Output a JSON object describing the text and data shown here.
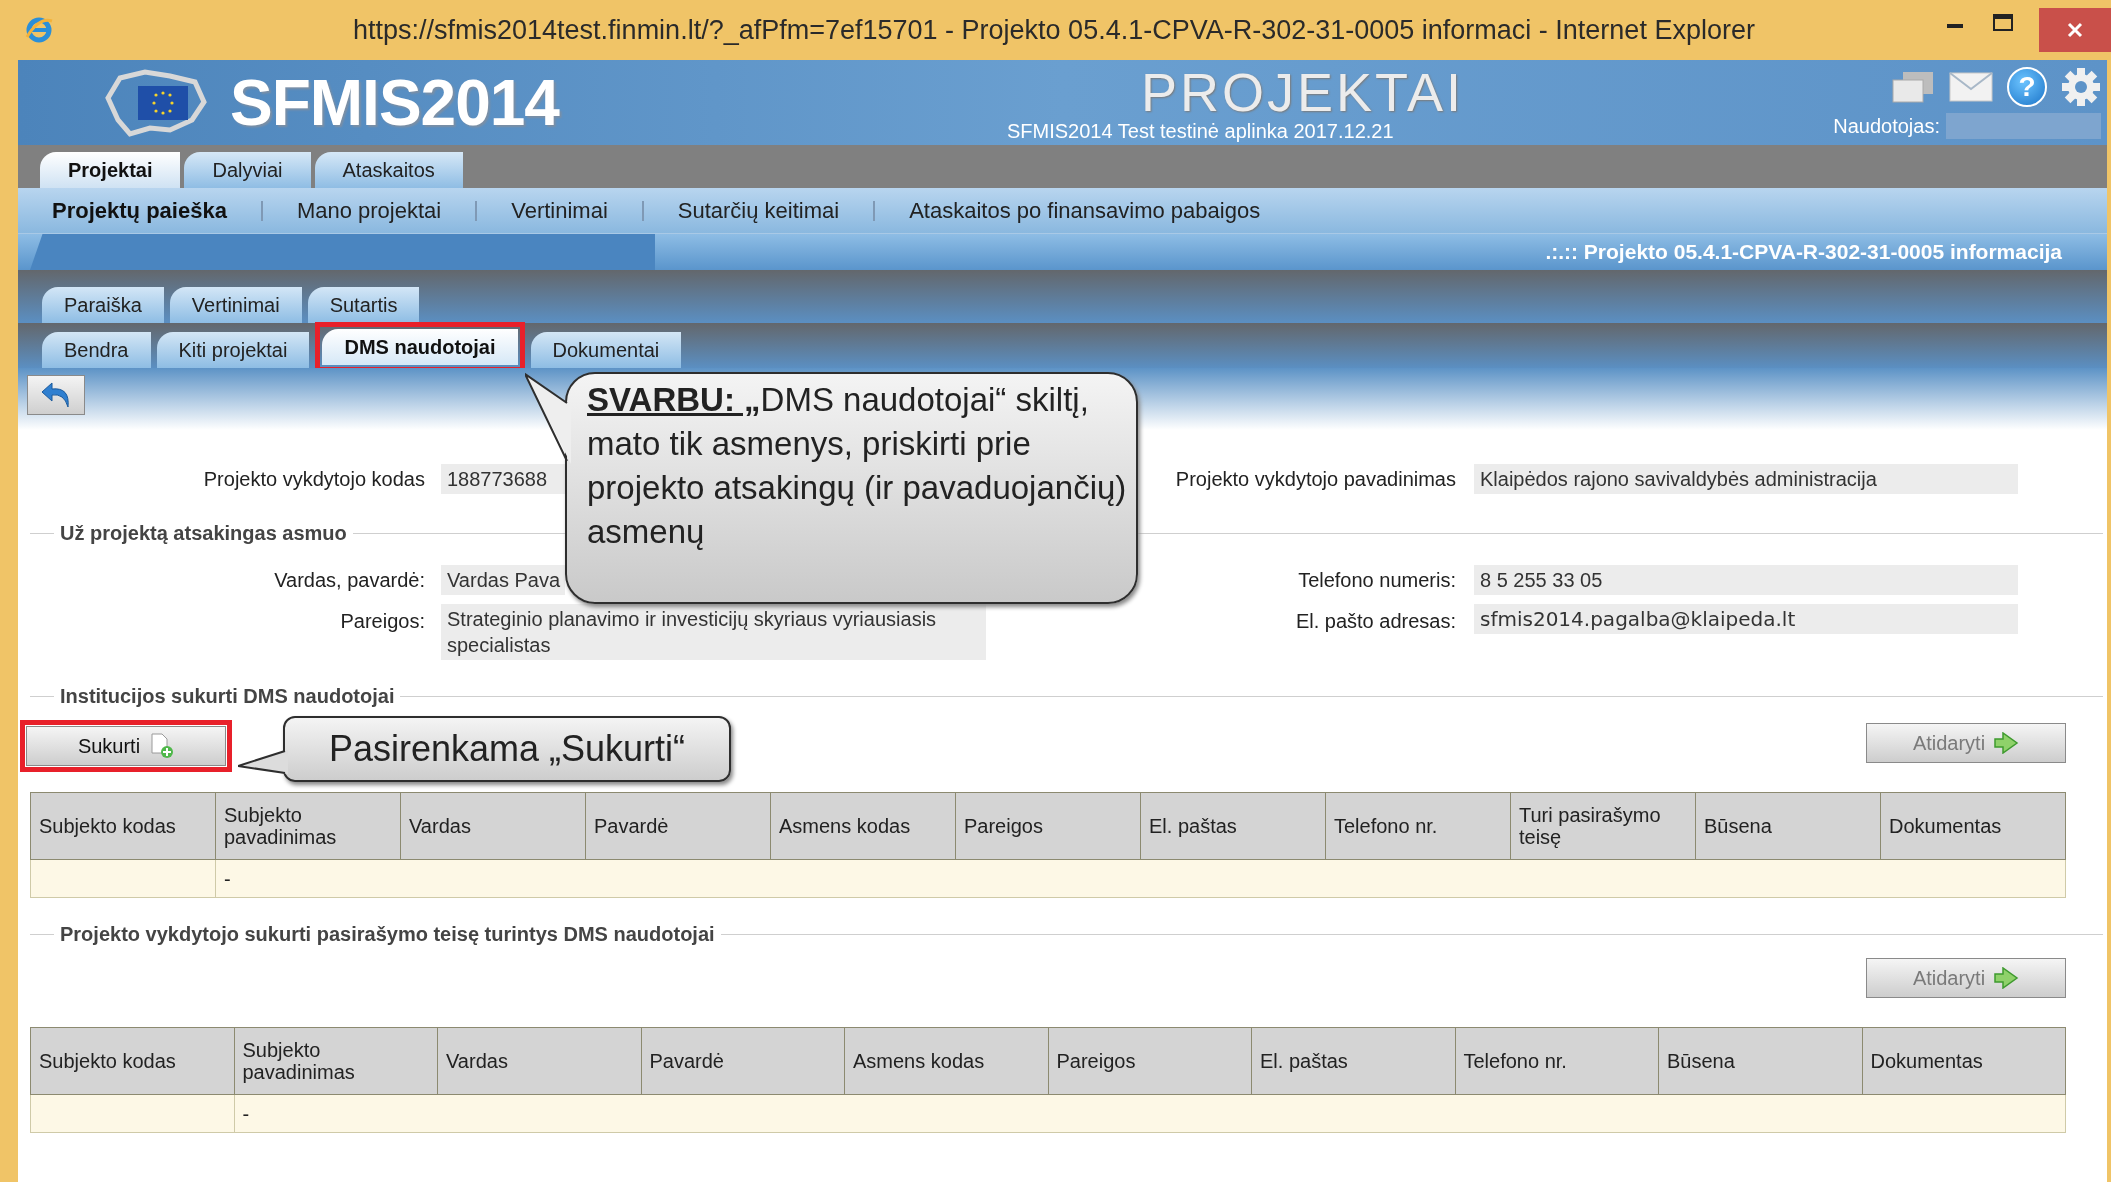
{
  "window": {
    "title": "https://sfmis2014test.finmin.lt/?_afPfm=7ef15701 - Projekto 05.4.1-CPVA-R-302-31-0005 informaci - Internet Explorer"
  },
  "header": {
    "logo_text": "SFMIS2014",
    "app_title": "PROJEKTAI",
    "environment": "SFMIS2014 Test testinė aplinka 2017.12.21",
    "user_label": "Naudotojas:",
    "help_glyph": "?"
  },
  "main_tabs": [
    {
      "label": "Projektai",
      "selected": true
    },
    {
      "label": "Dalyviai",
      "selected": false
    },
    {
      "label": "Ataskaitos",
      "selected": false
    }
  ],
  "menu": [
    {
      "label": "Projektų paieška",
      "selected": true
    },
    {
      "label": "Mano projektai",
      "selected": false
    },
    {
      "label": "Vertinimai",
      "selected": false
    },
    {
      "label": "Sutarčių keitimai",
      "selected": false
    },
    {
      "label": "Ataskaitos po finansavimo pabaigos",
      "selected": false
    }
  ],
  "page_title": ".:.:: Projekto 05.4.1-CPVA-R-302-31-0005 informacija",
  "tab_rows": [
    {
      "tabs": [
        {
          "label": "Paraiška",
          "selected": false,
          "highlighted": false
        },
        {
          "label": "Vertinimai",
          "selected": false,
          "highlighted": false
        },
        {
          "label": "Sutartis",
          "selected": false,
          "highlighted": false
        }
      ]
    },
    {
      "tabs": [
        {
          "label": "Bendra",
          "selected": false,
          "highlighted": false
        },
        {
          "label": "Kiti projektai",
          "selected": false,
          "highlighted": false
        },
        {
          "label": "DMS naudotojai",
          "selected": true,
          "highlighted": true
        },
        {
          "label": "Dokumentai",
          "selected": false,
          "highlighted": false
        }
      ]
    }
  ],
  "project": {
    "code_label": "Projekto vykdytojo kodas",
    "code": "188773688",
    "name_label": "Projekto vykdytojo pavadinimas",
    "name": "Klaipėdos rajono savivaldybės administracija"
  },
  "responsible": {
    "title": "Už projektą atsakingas asmuo",
    "name_label": "Vardas, pavardė:",
    "name": "Vardas Pava",
    "position_label": "Pareigos:",
    "position": "Strateginio planavimo ir investicijų skyriaus vyriausiasis specialistas",
    "phone_label": "Telefono numeris:",
    "phone": "8 5 255 33 05",
    "email_label": "El. pašto adresas:",
    "email": "sfmis2014.pagalba@klaipeda.lt"
  },
  "sections": [
    {
      "title": "Institucijos sukurti DMS naudotojai",
      "buttons": [
        {
          "label": "Sukurti",
          "kind": "create",
          "disabled": false,
          "highlighted": true
        },
        {
          "label": "Atidaryti",
          "kind": "open",
          "disabled": true,
          "highlighted": false
        }
      ],
      "columns": [
        "Subjekto kodas",
        "Subjekto pavadinimas",
        "Vardas",
        "Pavardė",
        "Asmens kodas",
        "Pareigos",
        "El. paštas",
        "Telefono nr.",
        "Turi pasirašymo teisę",
        "Būsena",
        "Dokumentas"
      ],
      "empty_row": "-"
    },
    {
      "title": "Projekto vykdytojo sukurti pasirašymo teisę turintys DMS naudotojai",
      "buttons": [
        {
          "label": "Atidaryti",
          "kind": "open",
          "disabled": true,
          "highlighted": false
        }
      ],
      "columns": [
        "Subjekto kodas",
        "Subjekto pavadinimas",
        "Vardas",
        "Pavardė",
        "Asmens kodas",
        "Pareigos",
        "El. paštas",
        "Telefono nr.",
        "Būsena",
        "Dokumentas"
      ],
      "empty_row": "-"
    }
  ],
  "callouts": [
    {
      "lead": "SVARBU: „",
      "text": "DMS naudotojai“ skiltį, mato tik asmenys, priskirti prie projekto atsakingų (ir pavaduojančių) asmenų"
    },
    {
      "text": "Pasirenkama „Sukurti“"
    }
  ]
}
